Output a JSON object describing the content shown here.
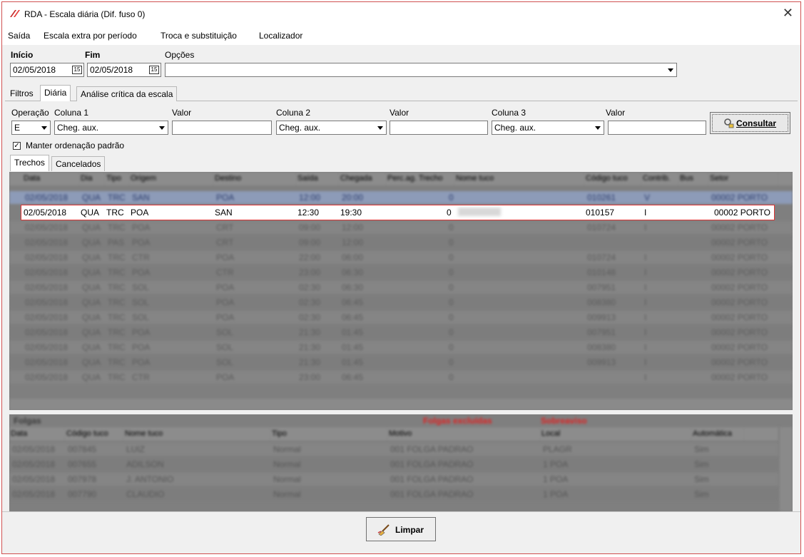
{
  "window": {
    "title": "RDA - Escala diária (Dif. fuso 0)"
  },
  "menu": [
    "Saída",
    "Escala extra por período",
    "Troca e substituição",
    "Localizador"
  ],
  "filters": {
    "inicio_label": "Início",
    "fim_label": "Fim",
    "opcoes_label": "Opções",
    "inicio_value": "02/05/2018",
    "fim_value": "02/05/2018",
    "opcoes_value": ""
  },
  "main_tabs": [
    "Filtros",
    "Diária",
    "Análise crítica da escala"
  ],
  "query": {
    "operacao_label": "Operação",
    "coluna1_label": "Coluna 1",
    "valor_label": "Valor",
    "coluna2_label": "Coluna 2",
    "coluna3_label": "Coluna 3",
    "operacao_value": "E",
    "coluna1_value": "Cheg. aux.",
    "coluna2_value": "Cheg. aux.",
    "coluna3_value": "Cheg. aux.",
    "valor1": "",
    "valor2": "",
    "valor3": "",
    "consultar_label": "Consultar",
    "manter_label": "Manter ordenação padrão"
  },
  "sub_tabs": [
    "Trechos",
    "Cancelados"
  ],
  "trechos": {
    "columns": [
      "Data",
      "Dia",
      "Tipo",
      "Origem",
      "Destino",
      "Saída",
      "Chegada",
      "Perc.ag. Trecho",
      "Nome tuco",
      "Código tuco",
      "Contrib.",
      "Bus",
      "Setor"
    ],
    "first_row": [
      "02/05/2018",
      "QUA",
      "TRC",
      "SAN",
      "POA",
      "12:00",
      "20:00",
      "0",
      "",
      "010261",
      "V",
      "",
      "00002 PORTO"
    ],
    "selected_row": [
      "02/05/2018",
      "QUA",
      "TRC",
      "POA",
      "SAN",
      "12:30",
      "19:30",
      "0",
      "",
      "010157",
      "I",
      "",
      "00002 PORTO"
    ],
    "rows": [
      [
        "02/05/2018",
        "QUA",
        "TRC",
        "POA",
        "CRT",
        "09:00",
        "12:00",
        "0",
        "",
        "010724",
        "I",
        "",
        "00002 PORTO"
      ],
      [
        "02/05/2018",
        "QUA",
        "PAS",
        "POA",
        "CRT",
        "09:00",
        "12:00",
        "0",
        "",
        "",
        "",
        "",
        "00002 PORTO"
      ],
      [
        "02/05/2018",
        "QUA",
        "TRC",
        "CTR",
        "POA",
        "22:00",
        "06:00",
        "0",
        "",
        "010724",
        "I",
        "",
        "00002 PORTO"
      ],
      [
        "02/05/2018",
        "QUA",
        "TRC",
        "POA",
        "CTR",
        "23:00",
        "06:30",
        "0",
        "",
        "010148",
        "I",
        "",
        "00002 PORTO"
      ],
      [
        "02/05/2018",
        "QUA",
        "TRC",
        "SOL",
        "POA",
        "02:30",
        "06:30",
        "0",
        "",
        "007951",
        "I",
        "",
        "00002 PORTO"
      ],
      [
        "02/05/2018",
        "QUA",
        "TRC",
        "SOL",
        "POA",
        "02:30",
        "06:45",
        "0",
        "",
        "008380",
        "I",
        "",
        "00002 PORTO"
      ],
      [
        "02/05/2018",
        "QUA",
        "TRC",
        "SOL",
        "POA",
        "02:30",
        "06:45",
        "0",
        "",
        "009913",
        "I",
        "",
        "00002 PORTO"
      ],
      [
        "02/05/2018",
        "QUA",
        "TRC",
        "POA",
        "SOL",
        "21:30",
        "01:45",
        "0",
        "",
        "007951",
        "I",
        "",
        "00002 PORTO"
      ],
      [
        "02/05/2018",
        "QUA",
        "TRC",
        "POA",
        "SOL",
        "21:30",
        "01:45",
        "0",
        "",
        "008380",
        "I",
        "",
        "00002 PORTO"
      ],
      [
        "02/05/2018",
        "QUA",
        "TRC",
        "POA",
        "SOL",
        "21:30",
        "01:45",
        "0",
        "",
        "009913",
        "I",
        "",
        "00002 PORTO"
      ],
      [
        "02/05/2018",
        "QUA",
        "TRC",
        "CTR",
        "POA",
        "23:00",
        "06:45",
        "0",
        "",
        "",
        "I",
        "",
        "00002 PORTO"
      ]
    ]
  },
  "folgas": {
    "title": "Folgas",
    "legend_red_1": "Folgas excluídas",
    "legend_red_2": "Sobreaviso",
    "columns": [
      "Data",
      "Código tuco",
      "Nome tuco",
      "Tipo",
      "Motivo",
      "Local",
      "Automática"
    ],
    "rows": [
      [
        "02/05/2018",
        "007845",
        "LUIZ",
        "Normal",
        "001 FOLGA PADRAO",
        "PLAGR",
        "Sim"
      ],
      [
        "02/05/2018",
        "007655",
        "ADILSON",
        "Normal",
        "001 FOLGA PADRAO",
        "1 POA",
        "Sim"
      ],
      [
        "02/05/2018",
        "007978",
        "J. ANTONIO",
        "Normal",
        "001 FOLGA PADRAO",
        "1 POA",
        "Sim"
      ],
      [
        "02/05/2018",
        "007790",
        "CLAUDIO",
        "Normal",
        "001 FOLGA PADRAO",
        "1 POA",
        "Sim"
      ]
    ]
  },
  "footer": {
    "limpar_label": "Limpar"
  }
}
